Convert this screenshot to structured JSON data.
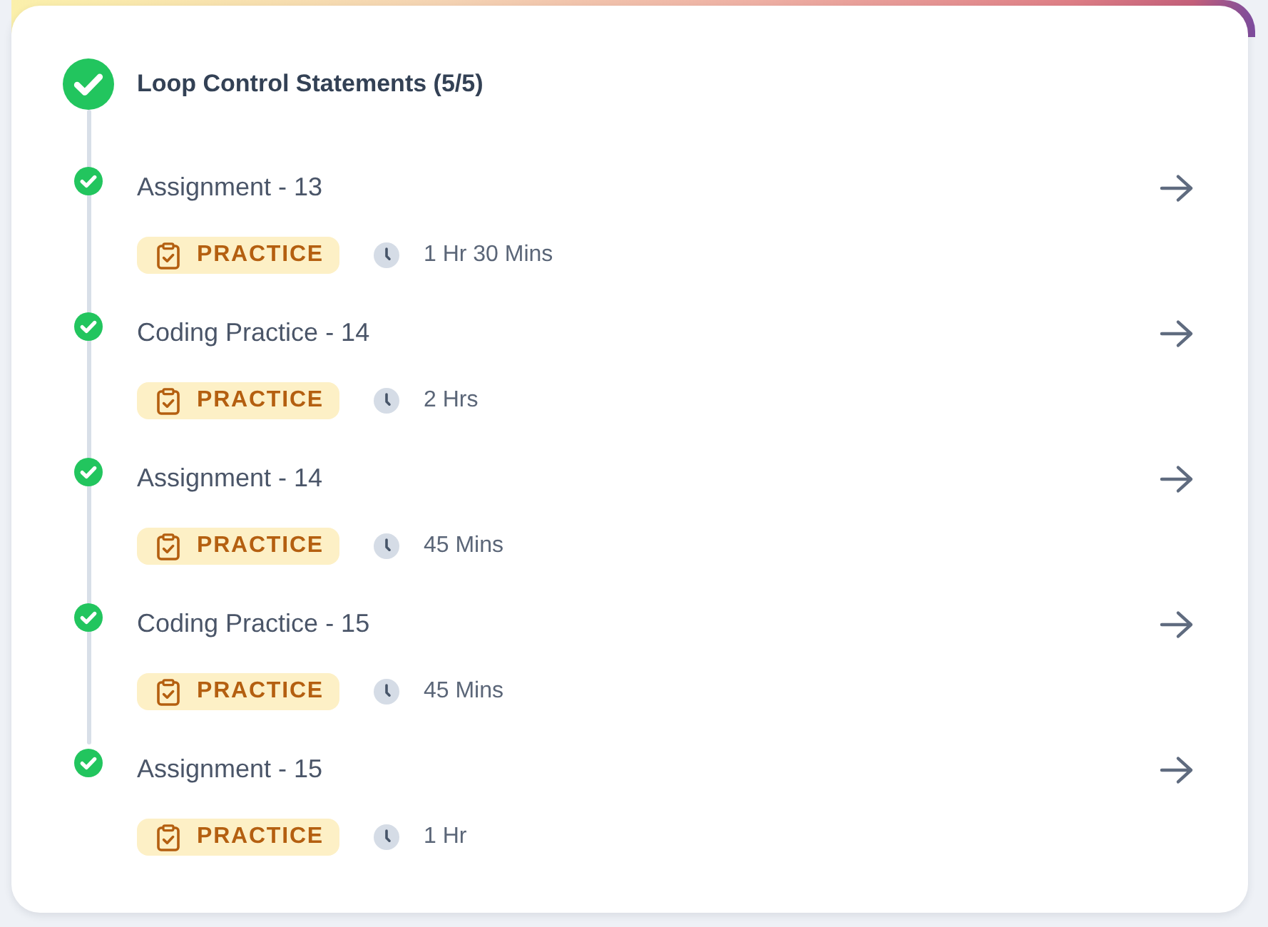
{
  "section": {
    "title": "Loop Control Statements (5/5)",
    "completed": true
  },
  "items": [
    {
      "title": "Assignment - 13",
      "completed": true,
      "tag": "PRACTICE",
      "duration": "1 Hr 30 Mins"
    },
    {
      "title": "Coding Practice - 14",
      "completed": true,
      "tag": "PRACTICE",
      "duration": "2 Hrs"
    },
    {
      "title": "Assignment - 14",
      "completed": true,
      "tag": "PRACTICE",
      "duration": "45 Mins"
    },
    {
      "title": "Coding Practice - 15",
      "completed": true,
      "tag": "PRACTICE",
      "duration": "45 Mins"
    },
    {
      "title": "Assignment - 15",
      "completed": true,
      "tag": "PRACTICE",
      "duration": "1 Hr"
    }
  ]
}
